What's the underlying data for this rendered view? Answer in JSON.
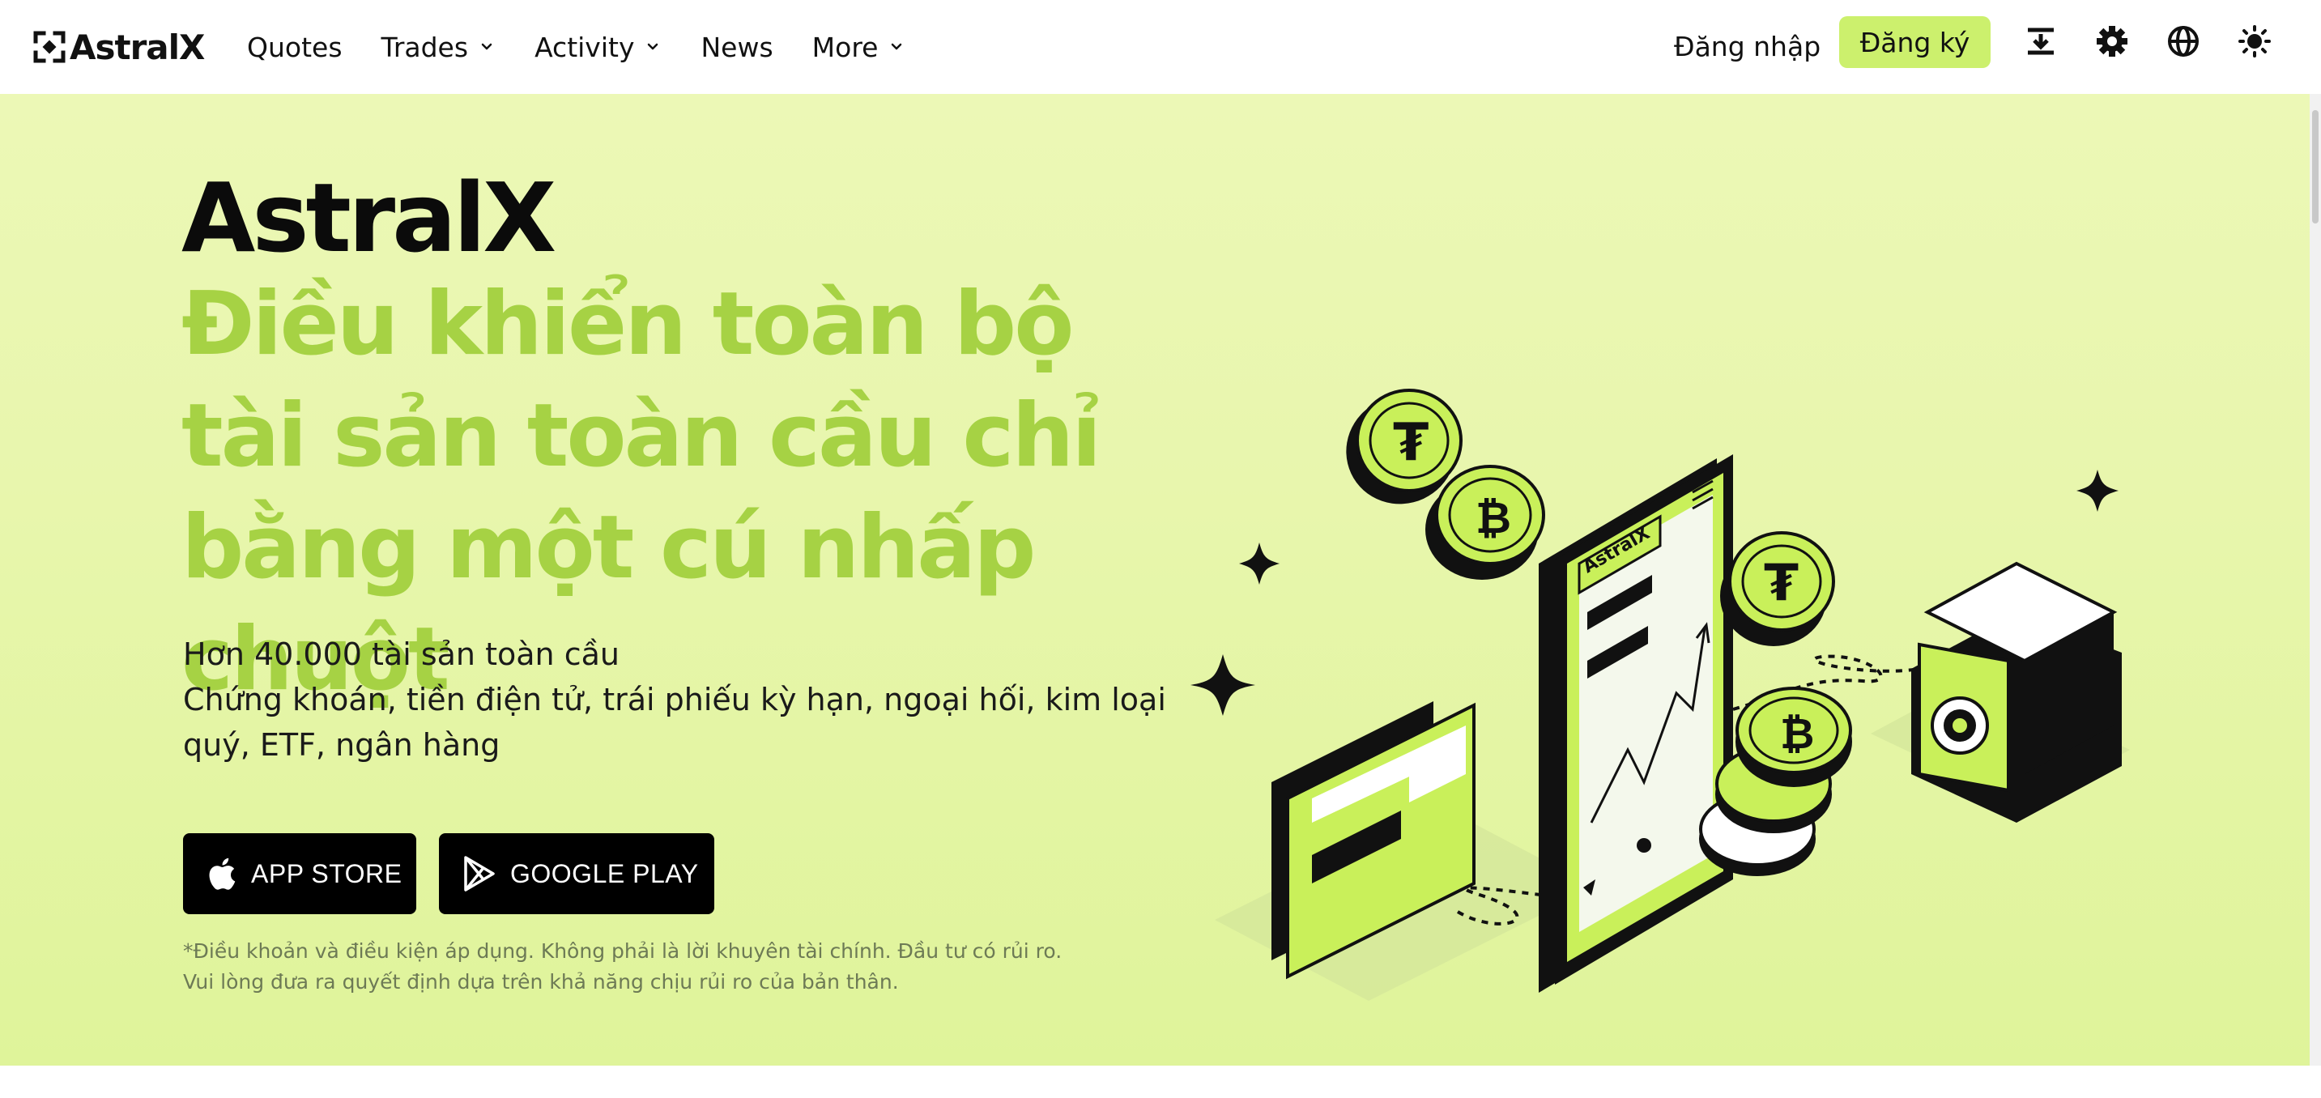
{
  "header": {
    "logo_text": "AstralX",
    "nav": [
      {
        "label": "Quotes",
        "has_dropdown": false
      },
      {
        "label": "Trades",
        "has_dropdown": true
      },
      {
        "label": "Activity",
        "has_dropdown": true
      },
      {
        "label": "News",
        "has_dropdown": false
      },
      {
        "label": "More",
        "has_dropdown": true
      }
    ],
    "login_label": "Đăng nhập",
    "signup_label": "Đăng ký",
    "icons": [
      "download-icon",
      "gear-icon",
      "globe-icon",
      "theme-sun-icon"
    ]
  },
  "hero": {
    "brand": "AstralX",
    "headline": "Điều khiển toàn bộ tài sản toàn cầu chỉ bằng một cú nhấp chuột",
    "sub_line1": "Hơn 40.000 tài sản toàn cầu",
    "sub_line2": "Chứng khoán, tiền điện tử, trái phiếu kỳ hạn, ngoại hối, kim loại quý, ETF, ngân hàng",
    "buttons": {
      "app_store": "APP STORE",
      "google_play": "GOOGLE PLAY"
    },
    "disclaimer_line1": "*Điều khoản và điều kiện áp dụng. Không phải là lời khuyên tài chính. Đầu tư có rủi ro.",
    "disclaimer_line2": "Vui lòng đưa ra quyết định dựa trên khả năng chịu rủi ro của bản thân.",
    "illustration_phone_label": "AstralX",
    "illustration_coin_symbols": [
      "₮",
      "₿",
      "₮",
      "₿"
    ]
  },
  "colors": {
    "accent": "#ccf06d",
    "headline_green": "#a6d244",
    "hero_bg_top": "#ecf8b6",
    "hero_bg_bottom": "#dff49a",
    "button_black": "#000000"
  }
}
